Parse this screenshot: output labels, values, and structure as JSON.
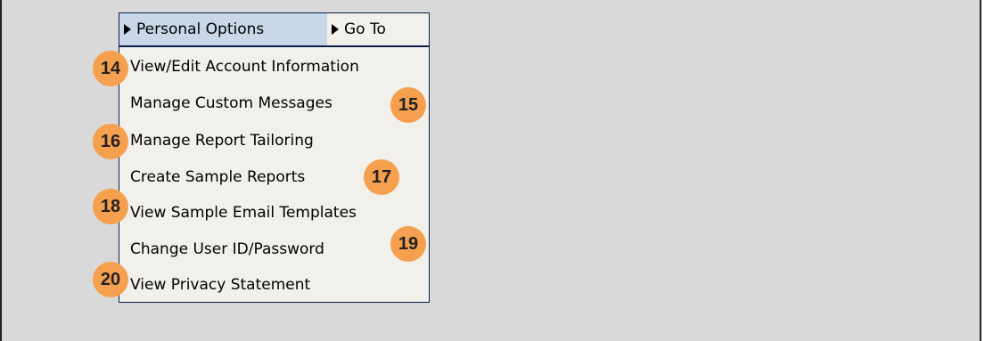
{
  "menu": {
    "tabs": {
      "personal_options": "Personal Options",
      "go_to": "Go To"
    },
    "items": [
      "View/Edit Account Information",
      "Manage Custom Messages",
      "Manage Report Tailoring",
      "Create Sample Reports",
      "View Sample Email Templates",
      "Change User ID/Password",
      "View Privacy Statement"
    ]
  },
  "callouts": [
    "14",
    "15",
    "16",
    "17",
    "18",
    "19",
    "20"
  ],
  "colors": {
    "background": "#d9d9d9",
    "menu_background": "#f2f0ea",
    "active_tab": "#c9d7e8",
    "menu_border": "#0b1f4d",
    "callout": "#f5a04e"
  }
}
